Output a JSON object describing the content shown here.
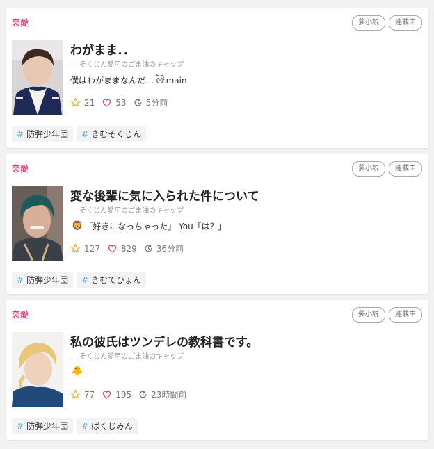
{
  "colors": {
    "genre": "#e8407a",
    "star": "#e8b21a",
    "heart": "#e8407a",
    "hash": "#4aa8d8"
  },
  "icons": {
    "star": "star-icon",
    "heart": "heart-icon",
    "time": "clock-refresh-icon"
  },
  "cards": [
    {
      "genre": "恋愛",
      "badges": [
        "夢小説",
        "連載中"
      ],
      "title": "わがまま．．",
      "author": "― そくじん愛用のごま油のキャップ",
      "desc_prefix": "",
      "desc_emoji": "",
      "desc": "僕はわがままなんだ…",
      "desc_suffix_emoji": "🐱",
      "desc_suffix": "main",
      "stars": "21",
      "hearts": "53",
      "time": "5分前",
      "tags": [
        "防弾少年団",
        "きむそくじん"
      ]
    },
    {
      "genre": "恋愛",
      "badges": [
        "夢小説",
        "連載中"
      ],
      "title": "変な後輩に気に入られた件について",
      "author": "― そくじん愛用のごま油のキャップ",
      "desc_prefix": "",
      "desc_emoji": "🦁",
      "desc": "「好きになっちゃった」 You「は？」",
      "desc_suffix_emoji": "",
      "desc_suffix": "",
      "stars": "127",
      "hearts": "829",
      "time": "36分前",
      "tags": [
        "防弾少年団",
        "きむてひょん"
      ]
    },
    {
      "genre": "恋愛",
      "badges": [
        "夢小説",
        "連載中"
      ],
      "title": "私の彼氏はツンデレの教科書です。",
      "author": "― そくじん愛用のごま油のキャップ",
      "desc_prefix": "",
      "desc_emoji": "🐥",
      "desc": "",
      "desc_suffix_emoji": "",
      "desc_suffix": "",
      "stars": "77",
      "hearts": "195",
      "time": "23時間前",
      "tags": [
        "防弾少年団",
        "ぱくじみん"
      ]
    }
  ]
}
